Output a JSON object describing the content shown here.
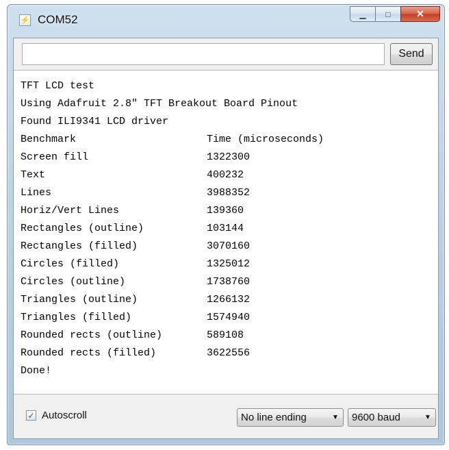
{
  "window": {
    "title": "COM52",
    "app_icon": "arduino-serial-icon",
    "controls": {
      "minimize_icon": "minimize-icon",
      "maximize_icon": "maximize-icon",
      "close_icon": "close-icon"
    }
  },
  "send_bar": {
    "input_value": "",
    "input_placeholder": "",
    "send_label": "Send"
  },
  "console": {
    "header_lines": [
      "TFT LCD test",
      "Using Adafruit 2.8\" TFT Breakout Board Pinout",
      "Found ILI9341 LCD driver"
    ],
    "benchmark_header": {
      "name": "Benchmark",
      "value": "Time (microseconds)"
    },
    "benchmarks": [
      {
        "name": "Screen fill",
        "value": "1322300"
      },
      {
        "name": "Text",
        "value": "400232"
      },
      {
        "name": "Lines",
        "value": "3988352"
      },
      {
        "name": "Horiz/Vert Lines",
        "value": "139360"
      },
      {
        "name": "Rectangles (outline)",
        "value": "103144"
      },
      {
        "name": "Rectangles (filled)",
        "value": "3070160"
      },
      {
        "name": "Circles (filled)",
        "value": "1325012"
      },
      {
        "name": "Circles (outline)",
        "value": "1738760"
      },
      {
        "name": "Triangles (outline)",
        "value": "1266132"
      },
      {
        "name": "Triangles (filled)",
        "value": "1574940"
      },
      {
        "name": "Rounded rects (outline)",
        "value": "589108"
      },
      {
        "name": "Rounded rects (filled)",
        "value": "3622556"
      }
    ],
    "footer_line": "Done!"
  },
  "bottom_bar": {
    "autoscroll_label": "Autoscroll",
    "autoscroll_checked": true,
    "line_ending": "No line ending",
    "baud_rate": "9600 baud"
  },
  "colors": {
    "titlebar_top": "#cfe0ee",
    "titlebar_bottom": "#aec7dd",
    "close_button": "#c43e24",
    "console_bg": "#ffffff",
    "panel_bg": "#f0f0f0"
  }
}
